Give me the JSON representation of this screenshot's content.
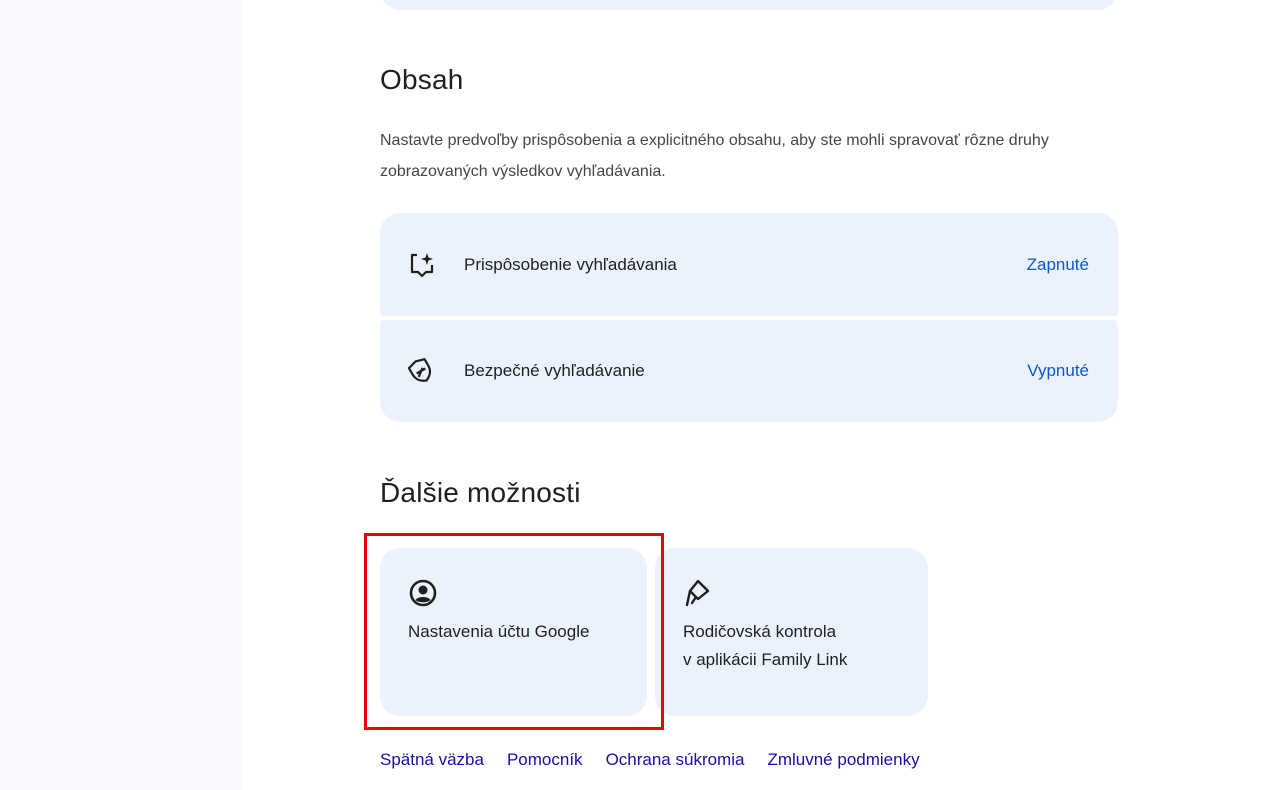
{
  "content_section": {
    "title": "Obsah",
    "description": "Nastavte predvoľby prispôsobenia a explicitného obsahu, aby ste mohli spravovať rôzne druhy zobrazovaných výsledkov vyhľadávania.",
    "rows": [
      {
        "icon": "personalization-sparkle-icon",
        "label": "Prispôsobenie vyhľadávania",
        "status": "Zapnuté"
      },
      {
        "icon": "safesearch-shield-icon",
        "label": "Bezpečné vyhľadávanie",
        "status": "Vypnuté"
      }
    ]
  },
  "more_options": {
    "title": "Ďalšie možnosti",
    "cards": [
      {
        "icon": "account-circle-icon",
        "label": "Nastavenia účtu Google"
      },
      {
        "icon": "family-link-icon",
        "label": "Rodičovská kontrola\nv aplikácii Family Link"
      }
    ]
  },
  "footer": {
    "links": [
      "Spätná väzba",
      "Pomocník",
      "Ochrana súkromia",
      "Zmluvné podmienky"
    ]
  },
  "colors": {
    "card_background": "#ecf2fd",
    "status_link": "#0b57d0",
    "footer_link": "#1a0dab",
    "highlight": "#ee0000"
  }
}
